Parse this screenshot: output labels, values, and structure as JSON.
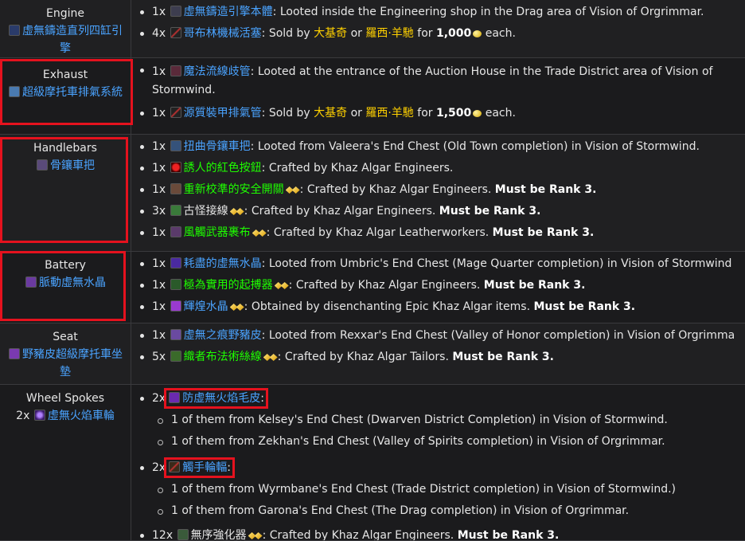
{
  "rows": [
    {
      "slot": "Engine",
      "part": "虛無鑄造直列四缸引擎",
      "items": [
        {
          "qty": "1x",
          "name": "虛無鑄造引擎本體",
          "text": ": Looted inside the Engineering shop in the Drag area of Vision of Orgrimmar."
        },
        {
          "qty": "4x",
          "name": "哥布林機械活塞",
          "text_a": ": Sold by ",
          "vendor1": "大基奇",
          "or": " or ",
          "vendor2": "羅西·羊馳",
          "text_b": " for ",
          "price": "1,000",
          "text_c": " each."
        }
      ]
    },
    {
      "slot": "Exhaust",
      "part": "超級摩托車排氣系統",
      "items": [
        {
          "qty": "1x",
          "name": "魔法流線歧管",
          "text": ": Looted at the entrance of the Auction House in the Trade District area of Vision of",
          "text2": "Stormwind."
        },
        {
          "qty": "1x",
          "name": "源質裝甲排氣管",
          "text_a": ": Sold by ",
          "vendor1": "大基奇",
          "or": " or ",
          "vendor2": "羅西·羊馳",
          "text_b": " for ",
          "price": "1,500",
          "text_c": " each."
        }
      ]
    },
    {
      "slot": "Handlebars",
      "part": "骨鑲車把",
      "items": [
        {
          "qty": "1x",
          "name": "扭曲骨鑲車把",
          "text": ": Looted from Valeera's End Chest (Old Town completion) in Vision of Stormwind."
        },
        {
          "qty": "1x",
          "name": "誘人的紅色按鈕",
          "text": ": Crafted by Khaz Algar Engineers."
        },
        {
          "qty": "1x",
          "name": "重新校準的安全開關",
          "text": ": Crafted by Khaz Algar Engineers. ",
          "rank": "Must be Rank 3."
        },
        {
          "qty": "3x",
          "name": "古怪接線",
          "text": ": Crafted by Khaz Algar Engineers. ",
          "rank": "Must be Rank 3."
        },
        {
          "qty": "1x",
          "name": "風觸武器裹布",
          "text": ": Crafted by Khaz Algar Leatherworkers. ",
          "rank": "Must be Rank 3."
        }
      ]
    },
    {
      "slot": "Battery",
      "part": "脈動虛無水晶",
      "items": [
        {
          "qty": "1x",
          "name": "耗盡的虛無水晶",
          "text": ": Looted from Umbric's End Chest (Mage Quarter completion) in Vision of Stormwind"
        },
        {
          "qty": "1x",
          "name": "極為實用的起搏器",
          "text": ": Crafted by Khaz Algar Engineers. ",
          "rank": "Must be Rank 3."
        },
        {
          "qty": "1x",
          "name": "輝煌水晶",
          "text": ": Obtained by disenchanting Epic Khaz Algar items. ",
          "rank": "Must be Rank 3."
        }
      ]
    },
    {
      "slot": "Seat",
      "part": "野豬皮超級摩托車坐墊",
      "items": [
        {
          "qty": "1x",
          "name": "虛無之痕野豬皮",
          "text": ": Looted from Rexxar's End Chest (Valley of Honor completion) in Vision of Orgrimma"
        },
        {
          "qty": "5x",
          "name": "織者布法術絲線",
          "text": ": Crafted by Khaz Algar Tailors. ",
          "rank": "Must be Rank 3."
        }
      ]
    },
    {
      "slot": "Wheel Spokes",
      "part_qty": "2x",
      "part": "虛無火焰車輪",
      "items": [
        {
          "qty": "2x",
          "name": "防虛無火焰毛皮",
          "text": ":",
          "sub": [
            "1 of them from Kelsey's End Chest (Dwarven District Completion) in Vision of Stormwind.",
            "1 of them from Zekhan's End Chest (Valley of Spirits completion) in Vision of Orgrimmar."
          ]
        },
        {
          "qty": "2x",
          "name": "觸手輪輻",
          "text": ":",
          "sub": [
            "1 of them from Wyrmbane's End Chest (Trade District completion) in Vision of Stormwind.)",
            "1 of them from Garona's End Chest (The Drag completion) in Vision of Orgrimmar."
          ]
        },
        {
          "qty": "12x",
          "name": "無序強化器",
          "text": ": Crafted by Khaz Algar Engineers. ",
          "rank": "Must be Rank 3."
        }
      ]
    }
  ]
}
